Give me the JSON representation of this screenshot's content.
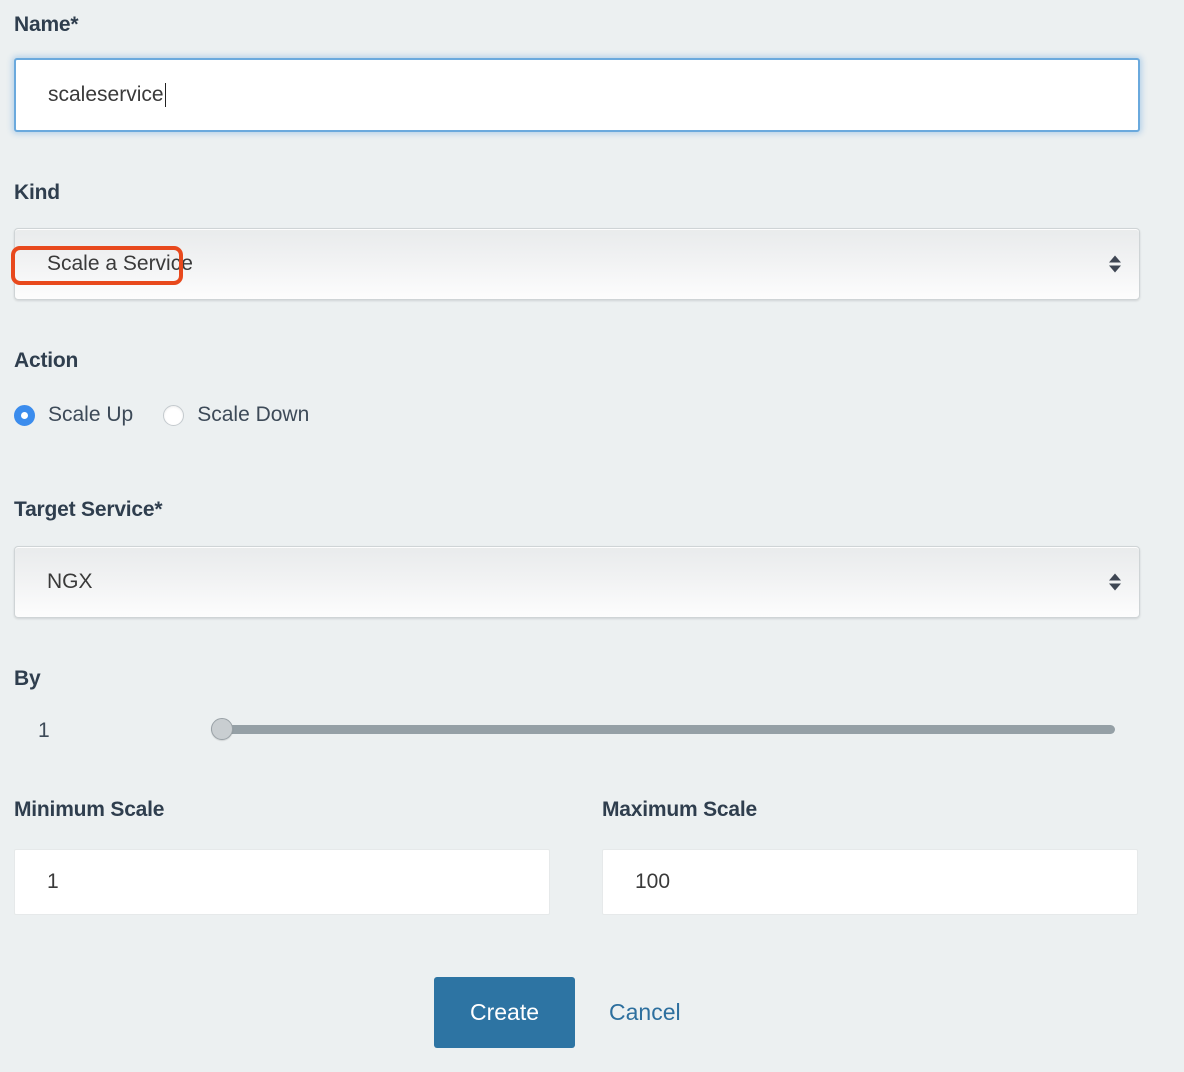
{
  "form": {
    "name": {
      "label": "Name*",
      "value": "scaleservice",
      "placeholder": "Name"
    },
    "kind": {
      "label": "Kind",
      "selected": "Scale a Service",
      "highlight_color": "#e8491d"
    },
    "action": {
      "label": "Action",
      "options": [
        {
          "label": "Scale Up",
          "selected": true
        },
        {
          "label": "Scale Down",
          "selected": false
        }
      ],
      "selected_color": "#3b8ced"
    },
    "target_service": {
      "label": "Target Service*",
      "selected": "NGX"
    },
    "by": {
      "label": "By",
      "value": "1",
      "slider_position_percent": 0
    },
    "minimum_scale": {
      "label": "Minimum Scale",
      "value": "1"
    },
    "maximum_scale": {
      "label": "Maximum Scale",
      "value": "100"
    },
    "buttons": {
      "create": "Create",
      "cancel": "Cancel",
      "create_color": "#2d74a3",
      "cancel_color": "#2d6f9e"
    }
  }
}
